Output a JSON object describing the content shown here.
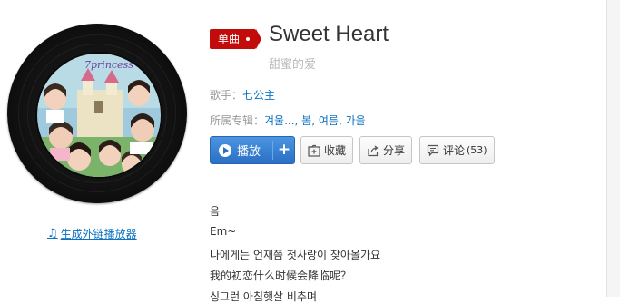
{
  "song": {
    "type_badge": "单曲",
    "title": "Sweet Heart",
    "subtitle": "甜蜜的爱",
    "artist_label": "歌手：",
    "artist": "七公主",
    "album_label": "所属专辑：",
    "album_parts": [
      "겨울...",
      "봄",
      "여름",
      "가을"
    ],
    "album_sep": ", ",
    "cover_text": "7princess"
  },
  "actions": {
    "play": "播放",
    "add": "+",
    "collect": "收藏",
    "share": "分享",
    "comment": "评论",
    "comment_count": "(53)"
  },
  "sidebar": {
    "generate_player_link": "生成外链播放器"
  },
  "lyrics": [
    "음",
    "Em~",
    "나에게는 언재쯤 첫사랑이 찾아올가요",
    "我的初恋什么时候会降临呢？",
    "싱그런 아침햇살 비추며"
  ],
  "colors": {
    "brand_red": "#c20c0c",
    "link_blue": "#0c73c2",
    "play_blue": "#2b6fc3"
  }
}
